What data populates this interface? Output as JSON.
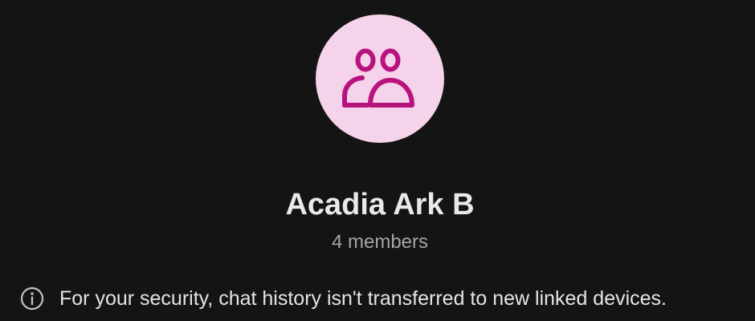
{
  "conversation": {
    "title": "Acadia Ark B",
    "member_count": "4 members",
    "avatar_icon": "group-icon",
    "security_notice": "For your security, chat history isn't transferred to new linked devices.",
    "notice_icon": "info-icon"
  },
  "colors": {
    "background": "#141414",
    "avatar_bg": "#f5d3ea",
    "avatar_icon": "#b8127f",
    "title_text": "#e9e9e9",
    "subtitle_text": "#a3a3a3",
    "notice_text": "#e4e4e4",
    "notice_icon": "#bfbfbf"
  }
}
